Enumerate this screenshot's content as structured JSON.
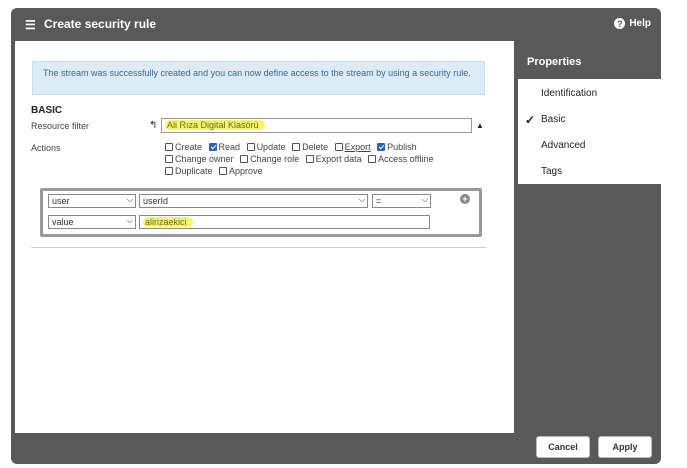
{
  "window": {
    "title": "Create security rule",
    "title_icon": "list-edit-icon",
    "help_label": "Help",
    "help_icon": "help-icon"
  },
  "info_message": "The stream was successfully created and you can now define access to the stream by using a security rule.",
  "basic": {
    "section_title": "BASIC",
    "resource_filter": {
      "label": "Resource filter",
      "value": "Ali Rıza Digital Klasörü",
      "arrow_icon": "curved-arrow-icon",
      "dropdown_icon": "triangle-up-icon"
    },
    "actions": {
      "label": "Actions",
      "items": [
        {
          "label": "Create",
          "checked": false
        },
        {
          "label": "Read",
          "checked": true
        },
        {
          "label": "Update",
          "checked": false
        },
        {
          "label": "Delete",
          "checked": false
        },
        {
          "label": "Export",
          "checked": false
        },
        {
          "label": "Publish",
          "checked": true
        },
        {
          "label": "Change owner",
          "checked": false
        },
        {
          "label": "Change role",
          "checked": false
        },
        {
          "label": "Export data",
          "checked": false
        },
        {
          "label": "Access offline",
          "checked": false
        },
        {
          "label": "Duplicate",
          "checked": false
        },
        {
          "label": "Approve",
          "checked": false
        }
      ]
    }
  },
  "condition": {
    "row1": {
      "type": "user",
      "property": "userId",
      "operator": "="
    },
    "row2": {
      "type": "value",
      "value": "alirizaekici"
    },
    "add_icon": "plus-circle-icon"
  },
  "properties": {
    "header": "Properties",
    "items": [
      {
        "label": "Identification",
        "active": false
      },
      {
        "label": "Basic",
        "active": true
      },
      {
        "label": "Advanced",
        "active": false
      },
      {
        "label": "Tags",
        "active": false
      }
    ]
  },
  "footer": {
    "cancel_label": "Cancel",
    "apply_label": "Apply"
  }
}
